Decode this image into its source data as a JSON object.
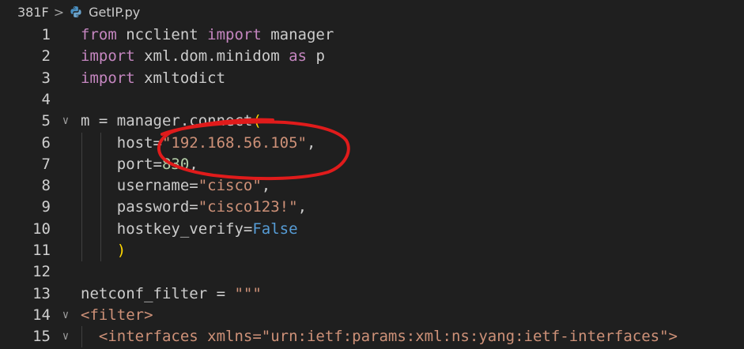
{
  "breadcrumb": {
    "folder": "381F",
    "separator": ">",
    "file": "GetIP.py",
    "file_icon": "python-icon"
  },
  "colors": {
    "background": "#1f1f1f",
    "keyword": "#c586c0",
    "string": "#ce9178",
    "number": "#b5cea8",
    "constant": "#569cd6",
    "bracket": "#ffd700",
    "annotation": "#e01b1b"
  },
  "editor": {
    "lines": [
      {
        "num": "1",
        "tokens": [
          {
            "t": "from",
            "c": "kw"
          },
          {
            "t": " ncclient ",
            "c": "id"
          },
          {
            "t": "import",
            "c": "kw"
          },
          {
            "t": " manager",
            "c": "id"
          }
        ]
      },
      {
        "num": "2",
        "tokens": [
          {
            "t": "import",
            "c": "kw"
          },
          {
            "t": " xml.dom.minidom ",
            "c": "id"
          },
          {
            "t": "as",
            "c": "kw"
          },
          {
            "t": " p",
            "c": "id"
          }
        ]
      },
      {
        "num": "3",
        "tokens": [
          {
            "t": "import",
            "c": "kw"
          },
          {
            "t": " xmltodict",
            "c": "id"
          }
        ]
      },
      {
        "num": "4",
        "tokens": []
      },
      {
        "num": "5",
        "fold": "v",
        "tokens": [
          {
            "t": "m = manager.connect",
            "c": "id"
          },
          {
            "t": "(",
            "c": "paren"
          }
        ]
      },
      {
        "num": "6",
        "tokens": [
          {
            "t": "    host=",
            "c": "id"
          },
          {
            "t": "\"192.168.56.105\"",
            "c": "str"
          },
          {
            "t": ",",
            "c": "id"
          }
        ]
      },
      {
        "num": "7",
        "tokens": [
          {
            "t": "    port=",
            "c": "id"
          },
          {
            "t": "830",
            "c": "num"
          },
          {
            "t": ",",
            "c": "id"
          }
        ]
      },
      {
        "num": "8",
        "tokens": [
          {
            "t": "    username=",
            "c": "id"
          },
          {
            "t": "\"cisco\"",
            "c": "str"
          },
          {
            "t": ",",
            "c": "id"
          }
        ]
      },
      {
        "num": "9",
        "tokens": [
          {
            "t": "    password=",
            "c": "id"
          },
          {
            "t": "\"cisco123!\"",
            "c": "str"
          },
          {
            "t": ",",
            "c": "id"
          }
        ]
      },
      {
        "num": "10",
        "tokens": [
          {
            "t": "    hostkey_verify=",
            "c": "id"
          },
          {
            "t": "False",
            "c": "const"
          }
        ]
      },
      {
        "num": "11",
        "tokens": [
          {
            "t": "    ",
            "c": "id"
          },
          {
            "t": ")",
            "c": "paren"
          }
        ]
      },
      {
        "num": "12",
        "tokens": []
      },
      {
        "num": "13",
        "tokens": [
          {
            "t": "netconf_filter = ",
            "c": "id"
          },
          {
            "t": "\"\"\"",
            "c": "str"
          }
        ]
      },
      {
        "num": "14",
        "fold": "v",
        "tokens": [
          {
            "t": "<filter>",
            "c": "tag"
          }
        ]
      },
      {
        "num": "15",
        "fold": "v",
        "tokens": [
          {
            "t": "  <interfaces xmlns=\"urn:ietf:params:xml:ns:yang:ietf-interfaces\">",
            "c": "tag"
          }
        ]
      }
    ]
  }
}
